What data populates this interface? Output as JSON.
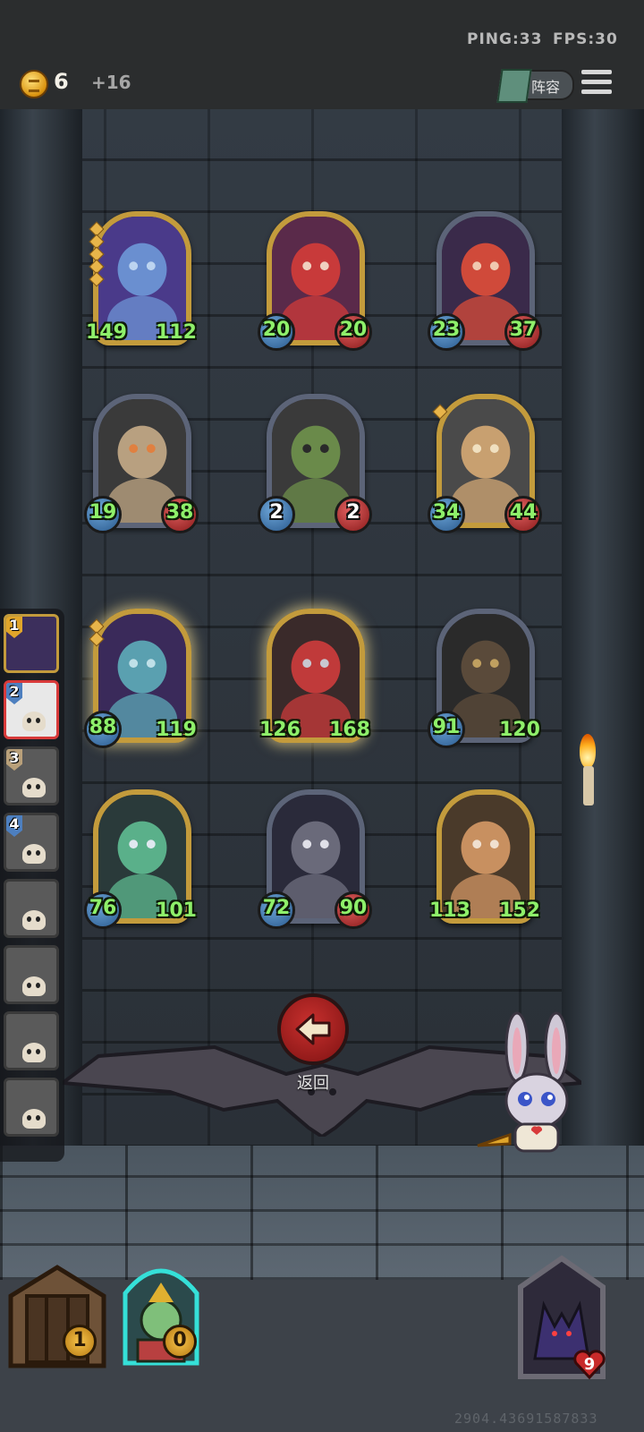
{
  "status": {
    "ping": "PING:33",
    "fps": "FPS:30"
  },
  "economy": {
    "coins": "6",
    "income": "+16"
  },
  "toolbar": {
    "lineup_label": "阵容"
  },
  "board": [
    {
      "atk": "149",
      "hp": "112",
      "frame": "gold",
      "tier": 5,
      "portrait": "blue-dragon"
    },
    {
      "atk": "20",
      "hp": "20",
      "frame": "gold",
      "tier": 0,
      "portrait": "red-witch"
    },
    {
      "atk": "23",
      "hp": "37",
      "frame": "silver",
      "tier": 0,
      "portrait": "horned-girl"
    },
    {
      "atk": "19",
      "hp": "38",
      "frame": "silver",
      "tier": 0,
      "portrait": "tree-ent"
    },
    {
      "atk": "2",
      "hp": "2",
      "frame": "silver",
      "tier": 0,
      "portrait": "goblin-hat"
    },
    {
      "atk": "34",
      "hp": "44",
      "frame": "gold",
      "tier": 1,
      "portrait": "squirrel"
    },
    {
      "atk": "88",
      "hp": "119",
      "frame": "gold",
      "tier": 2,
      "portrait": "elf-sorceress"
    },
    {
      "atk": "126",
      "hp": "168",
      "frame": "gold",
      "tier": 0,
      "portrait": "red-vampire"
    },
    {
      "atk": "91",
      "hp": "120",
      "frame": "silver",
      "tier": 0,
      "portrait": "stone-golem"
    },
    {
      "atk": "76",
      "hp": "101",
      "frame": "gold",
      "tier": 0,
      "portrait": "green-troll"
    },
    {
      "atk": "72",
      "hp": "90",
      "frame": "silver",
      "tier": 0,
      "portrait": "raccoon-monster"
    },
    {
      "atk": "113",
      "hp": "152",
      "frame": "gold",
      "tier": 0,
      "portrait": "detective-girl"
    }
  ],
  "players": [
    {
      "rank": "1",
      "style": "gold"
    },
    {
      "rank": "2",
      "style": "red"
    },
    {
      "rank": "3",
      "style": "grey"
    },
    {
      "rank": "4",
      "style": "grey"
    },
    {
      "rank": "",
      "style": "grey"
    },
    {
      "rank": "",
      "style": "grey"
    },
    {
      "rank": "",
      "style": "grey"
    },
    {
      "rank": "",
      "style": "grey"
    }
  ],
  "nav": {
    "return_label": "返回"
  },
  "bottom": {
    "tavern_count": "1",
    "hero_count": "0",
    "lives": "9"
  },
  "build_id": "2904.43691587833",
  "colors": {
    "gold_frame": "#c39b3c",
    "silver_frame": "#5c6478",
    "atk_green": "#8ef06a",
    "return_red": "#c8302e"
  }
}
